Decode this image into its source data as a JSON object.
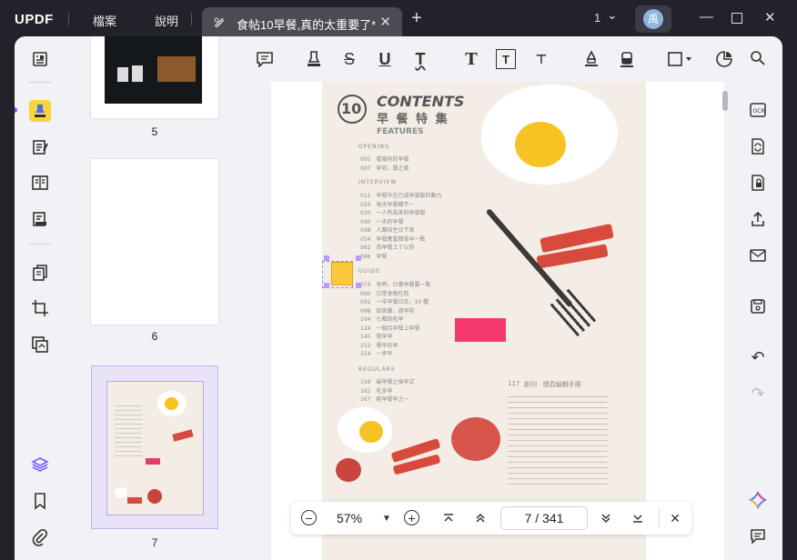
{
  "app": {
    "logo": "UPDF",
    "menu": [
      "檔案",
      "說明"
    ]
  },
  "tab": {
    "title": "食帖10早餐,真的太重要了*",
    "close": "✕",
    "new": "+"
  },
  "titlebar": {
    "page_indicator": "1",
    "avatar": "禹"
  },
  "thumbnails": [
    {
      "label": "5"
    },
    {
      "label": "6"
    },
    {
      "label": "7"
    }
  ],
  "zoom": {
    "value": "57%",
    "current_page": "7",
    "total_pages": "341",
    "separator": "/"
  },
  "pdf": {
    "number": "10",
    "heading": "CONTENTS",
    "subheading": "早 餐 特 集",
    "features": "FEATURES",
    "sections": [
      "OPENING",
      "INTERVIEW",
      "GUIDE",
      "REGULARS"
    ],
    "opening": [
      [
        "005",
        "看綠色的早餐"
      ],
      [
        "007",
        "早安，晨之美"
      ]
    ],
    "interview": [
      [
        "011",
        "早餐外在已成早餐飯的動力"
      ],
      [
        "024",
        "每天早餐都不一"
      ],
      [
        "030",
        "一人所為來的早餐飯"
      ],
      [
        "040",
        "一天的早餐"
      ],
      [
        "048",
        "人類自生日下來"
      ],
      [
        "054",
        "早餐應當簡單早一點"
      ],
      [
        "062",
        "而早餐上了以前"
      ],
      [
        "066",
        "早餐"
      ]
    ],
    "guide": [
      [
        "074",
        "有時，仕麥早餐要一點"
      ],
      [
        "090",
        "日常食物在前"
      ],
      [
        "092",
        "一中早餐日合，10 種"
      ],
      [
        "098",
        "四周叢，過早前"
      ],
      [
        "104",
        "七都說吃早"
      ],
      [
        "124",
        "一個月早餐上早餐"
      ],
      [
        "145",
        "發早早"
      ],
      [
        "152",
        "餐早的早"
      ],
      [
        "154",
        "一步早"
      ]
    ],
    "regulars": [
      [
        "156",
        "最早餐之後早式"
      ],
      [
        "162",
        "吃多早"
      ],
      [
        "167",
        "輕早餐早之一"
      ]
    ],
    "credits_no": "117",
    "credits_title": "創刊 · 總頁編輯手冊"
  }
}
